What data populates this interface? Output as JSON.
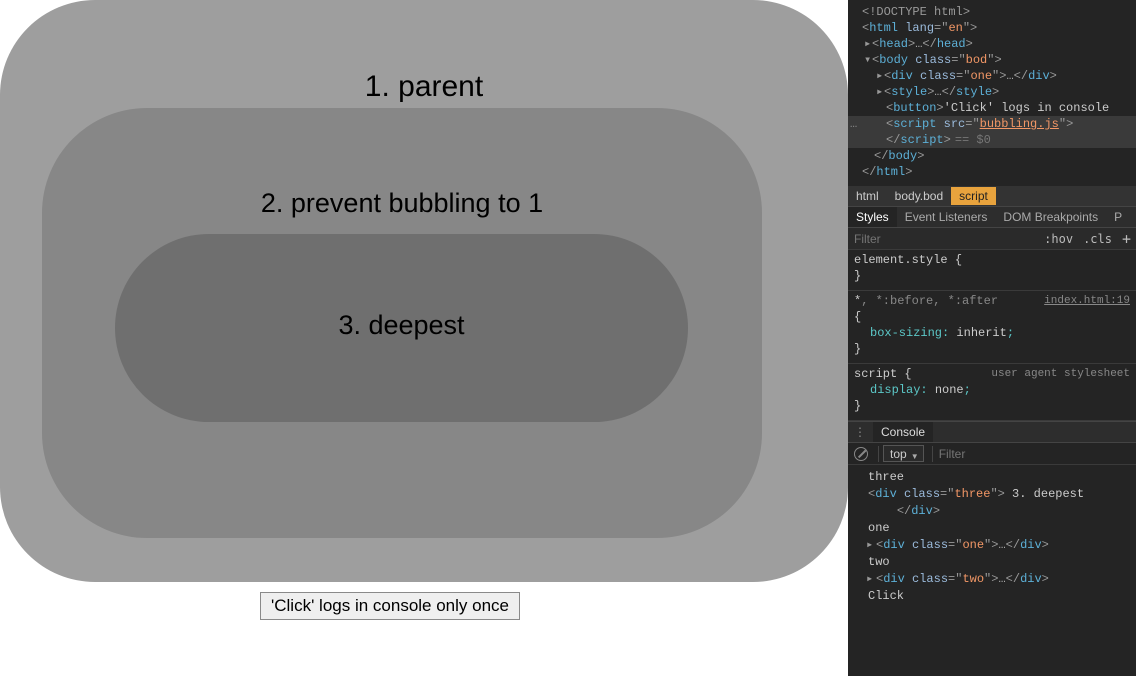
{
  "page": {
    "box1_label": "1. parent",
    "box2_label": "2. prevent bubbling to 1",
    "box3_label": "3. deepest",
    "button_label": "'Click' logs in console only once"
  },
  "elements": {
    "doctype": "<!DOCTYPE html>",
    "html_open_tag": "html",
    "html_lang_attr": "lang",
    "html_lang_val": "en",
    "head_tag": "head",
    "body_tag": "body",
    "body_class_attr": "class",
    "body_class_val": "bod",
    "div_tag": "div",
    "div_class_val": "one",
    "style_tag": "style",
    "button_tag": "button",
    "button_text": "'Click' logs in console",
    "script_tag": "script",
    "script_src_attr": "src",
    "script_src_val": "bubbling.js",
    "selected_marker": "== $0"
  },
  "breadcrumb": {
    "items": [
      "html",
      "body.bod",
      "script"
    ]
  },
  "styles_tabs": [
    "Styles",
    "Event Listeners",
    "DOM Breakpoints",
    "P"
  ],
  "styles_filter": {
    "placeholder": "Filter",
    "hov": ":hov",
    "cls": ".cls",
    "plus": "+"
  },
  "rules": {
    "r1_sel": "element.style",
    "r2_sel_main": "*",
    "r2_sel_dim": ", *:before, *:after",
    "r2_link": "index.html:19",
    "r2_prop": "box-sizing",
    "r2_val": "inherit",
    "r3_sel": "script",
    "r3_label": "user agent stylesheet",
    "r3_prop": "display",
    "r3_val": "none"
  },
  "console": {
    "title": "Console",
    "context": "top",
    "filter_placeholder": "Filter",
    "logs": {
      "l1": "three",
      "l1_el_class": "three",
      "l1_el_text": " 3. deepest ",
      "l2": "one",
      "l2_el_class": "one",
      "l3": "two",
      "l3_el_class": "two",
      "l4": "Click"
    }
  }
}
